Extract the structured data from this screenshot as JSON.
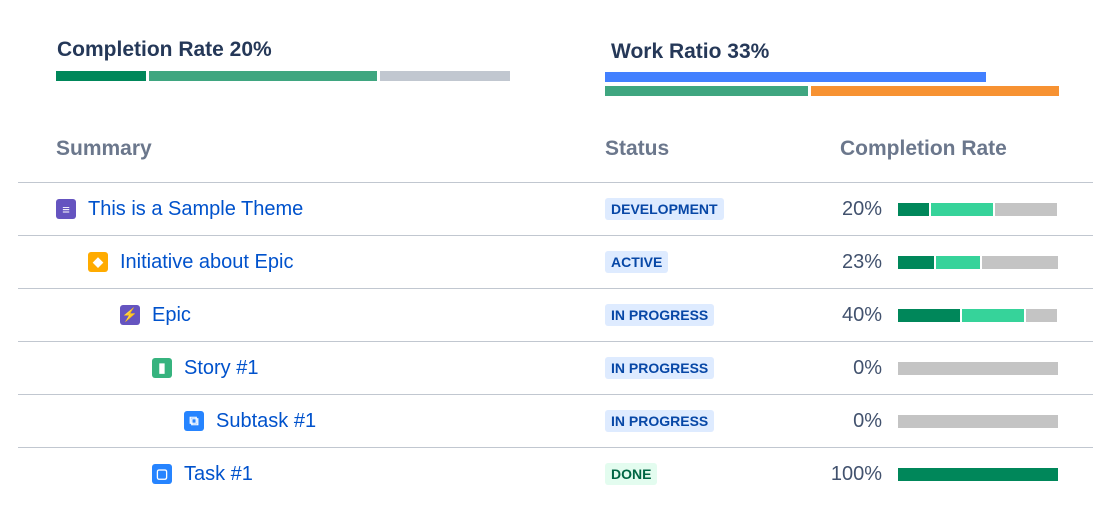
{
  "completion_summary": {
    "title": "Completion Rate 20%",
    "value_percent": 20,
    "segments": [
      {
        "share": 0.2,
        "color": "#00875a"
      },
      {
        "share": 0.51,
        "color": "#3fa680"
      },
      {
        "share": 0.29,
        "color": "#c1c7d0"
      }
    ]
  },
  "work_ratio": {
    "title": "Work Ratio 33%",
    "value_percent": 33,
    "top_bar": {
      "share": 0.84,
      "color": "#4280ff"
    },
    "bottom_segments": [
      {
        "share": 0.45,
        "color": "#3fa680"
      },
      {
        "share": 0.55,
        "color": "#f79232"
      }
    ]
  },
  "table": {
    "headers": {
      "summary": "Summary",
      "status": "Status",
      "completion": "Completion Rate"
    },
    "rows": [
      {
        "title": "This is a Sample Theme",
        "icon": "theme-icon",
        "icon_color": "#6554c0",
        "status": "DEVELOPMENT",
        "status_kind": "blue",
        "percent_label": "20%",
        "completion": {
          "done": 0.2,
          "in_progress": 0.4,
          "todo": 0.4
        }
      },
      {
        "title": "Initiative about Epic",
        "icon": "initiative-icon",
        "icon_color": "#ffab00",
        "status": "ACTIVE",
        "status_kind": "blue",
        "percent_label": "23%",
        "completion": {
          "done": 0.23,
          "in_progress": 0.28,
          "todo": 0.49
        }
      },
      {
        "title": "Epic",
        "icon": "epic-icon",
        "icon_color": "#6554c0",
        "status": "IN PROGRESS",
        "status_kind": "blue",
        "percent_label": "40%",
        "completion": {
          "done": 0.4,
          "in_progress": 0.4,
          "todo": 0.2
        }
      },
      {
        "title": "Story #1",
        "icon": "story-icon",
        "icon_color": "#36b37e",
        "status": "IN PROGRESS",
        "status_kind": "blue",
        "percent_label": "0%",
        "completion": {
          "done": 0,
          "in_progress": 0,
          "todo": 1
        }
      },
      {
        "title": "Subtask #1",
        "icon": "subtask-icon",
        "icon_color": "#2684ff",
        "status": "IN PROGRESS",
        "status_kind": "blue",
        "percent_label": "0%",
        "completion": {
          "done": 0,
          "in_progress": 0,
          "todo": 1
        }
      },
      {
        "title": "Task #1",
        "icon": "task-icon",
        "icon_color": "#2684ff",
        "status": "DONE",
        "status_kind": "green",
        "percent_label": "100%",
        "completion": {
          "done": 1,
          "in_progress": 0,
          "todo": 0
        }
      }
    ],
    "bar_colors": {
      "done": "#00875a",
      "in_progress": "#36d39a",
      "todo": "#c4c4c4"
    },
    "status_colors": {
      "blue": {
        "bg": "#deebff",
        "fg": "#0747a6"
      },
      "green": {
        "bg": "#e3fcef",
        "fg": "#006644"
      }
    }
  }
}
